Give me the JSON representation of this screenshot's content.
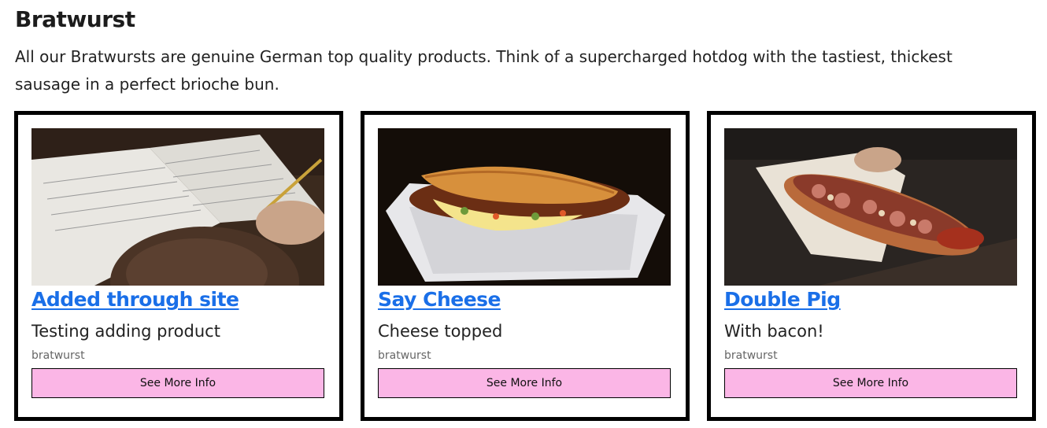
{
  "page": {
    "title": "Bratwurst",
    "description": "All our Bratwursts are genuine German top quality products. Think of a supercharged hotdog with the tastiest, thickest sausage in a perfect brioche bun."
  },
  "products": [
    {
      "title": "Added through site",
      "description": "Testing adding product",
      "category": "bratwurst",
      "button_label": "See More Info",
      "image": "notebook-photo"
    },
    {
      "title": "Say Cheese",
      "description": "Cheese topped",
      "category": "bratwurst",
      "button_label": "See More Info",
      "image": "cheese-hotdog-photo"
    },
    {
      "title": "Double Pig",
      "description": "With bacon!",
      "category": "bratwurst",
      "button_label": "See More Info",
      "image": "bacon-hotdog-photo"
    }
  ],
  "colors": {
    "link": "#1a6fe8",
    "button_bg": "#fbb6e6",
    "card_border": "#000000"
  }
}
